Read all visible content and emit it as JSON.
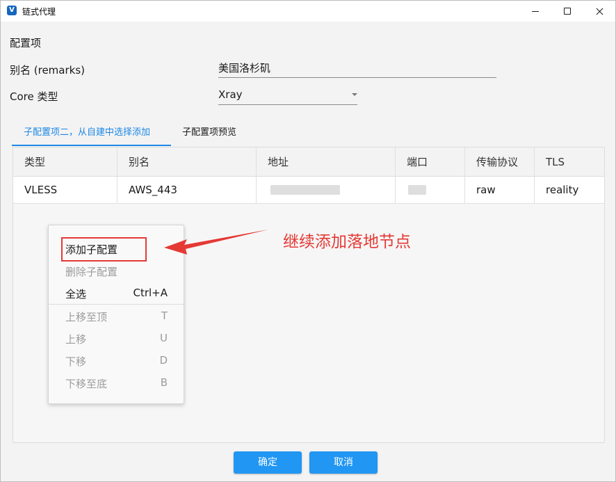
{
  "window": {
    "title": "链式代理",
    "icon": "v2rayn-logo-icon",
    "icon_text": "V"
  },
  "form": {
    "section_title": "配置项",
    "remarks_label": "别名 (remarks)",
    "remarks_value": "美国洛杉矶",
    "core_label": "Core 类型",
    "core_value": "Xray"
  },
  "tabs": [
    {
      "label": "子配置项二，从自建中选择添加",
      "active": true
    },
    {
      "label": "子配置项预览",
      "active": false
    }
  ],
  "table": {
    "columns": [
      "类型",
      "别名",
      "地址",
      "端口",
      "传输协议",
      "TLS"
    ],
    "rows": [
      {
        "type": "VLESS",
        "remarks": "AWS_443",
        "address": "",
        "port": "",
        "network": "raw",
        "tls": "reality"
      }
    ]
  },
  "context_menu": {
    "items": [
      {
        "label": "添加子配置",
        "shortcut": "",
        "enabled": true
      },
      {
        "label": "删除子配置",
        "shortcut": "",
        "enabled": false
      },
      {
        "label": "全选",
        "shortcut": "Ctrl+A",
        "enabled": true
      },
      {
        "label": "上移至顶",
        "shortcut": "T",
        "enabled": false
      },
      {
        "label": "上移",
        "shortcut": "U",
        "enabled": false
      },
      {
        "label": "下移",
        "shortcut": "D",
        "enabled": false
      },
      {
        "label": "下移至底",
        "shortcut": "B",
        "enabled": false
      }
    ]
  },
  "annotation": {
    "text": "继续添加落地节点",
    "color": "#e53935"
  },
  "buttons": {
    "ok": "确定",
    "cancel": "取消"
  },
  "colors": {
    "accent": "#1e88e5",
    "button": "#2196f3",
    "annotation": "#e53935"
  }
}
